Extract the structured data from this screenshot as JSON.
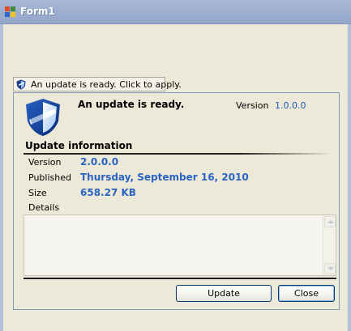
{
  "window": {
    "title": "Form1",
    "icon": "app-icon"
  },
  "notification": {
    "text": "An update is ready. Click to apply.",
    "icon": "shield-icon"
  },
  "update_panel": {
    "headline": "An update is ready.",
    "current_version_label": "Version",
    "current_version": "1.0.0.0",
    "section_title": "Update information",
    "info": {
      "version_label": "Version",
      "version": "2.0.0.0",
      "published_label": "Published",
      "published": "Thursday, September 16, 2010",
      "size_label": "Size",
      "size": "658.27 KB",
      "details_label": "Details"
    },
    "details_text": "",
    "buttons": {
      "update": "Update",
      "close": "Close"
    }
  },
  "colors": {
    "value_blue": "#2a63c2",
    "title_bar": "#9fb1d1",
    "window_bg": "#ece9d8"
  }
}
